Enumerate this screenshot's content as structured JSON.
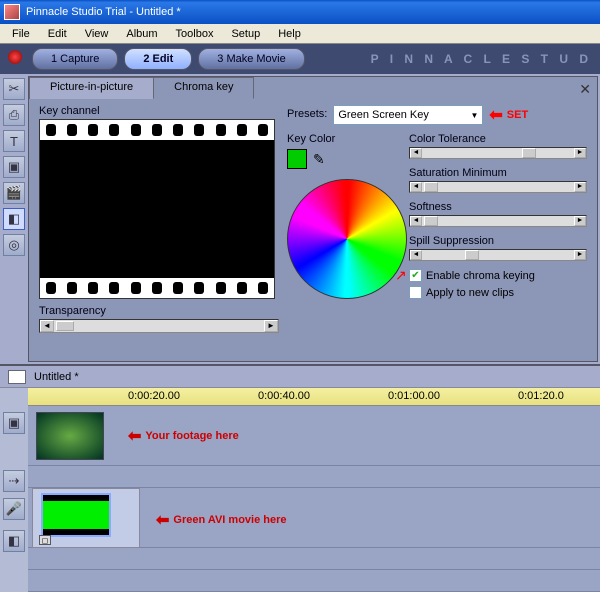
{
  "titlebar": {
    "text": "Pinnacle Studio Trial - Untitled *"
  },
  "menu": {
    "items": [
      "File",
      "Edit",
      "View",
      "Album",
      "Toolbox",
      "Setup",
      "Help"
    ]
  },
  "nav": {
    "tabs": [
      "1 Capture",
      "2 Edit",
      "3 Make Movie"
    ],
    "active": 1,
    "brand": "P I N N A C L E   S T U D"
  },
  "panel": {
    "tabs": [
      "Picture-in-picture",
      "Chroma key"
    ],
    "active": 1,
    "key_channel_label": "Key channel",
    "transparency_label": "Transparency",
    "presets_label": "Presets:",
    "preset_value": "Green Screen Key",
    "key_color_label": "Key Color",
    "sliders": {
      "tolerance": "Color Tolerance",
      "saturation": "Saturation Minimum",
      "softness": "Softness",
      "spill": "Spill Suppression"
    },
    "enable_label": "Enable chroma keying",
    "apply_label": "Apply to new clips",
    "enable_checked": true,
    "apply_checked": false
  },
  "annotations": {
    "set": "SET",
    "footage": "Your footage here",
    "green_avi": "Green AVI movie here"
  },
  "timeline": {
    "title": "Untitled *",
    "marks": [
      "0:00:20.00",
      "0:00:40.00",
      "0:01:00.00",
      "0:01:20.0"
    ]
  }
}
